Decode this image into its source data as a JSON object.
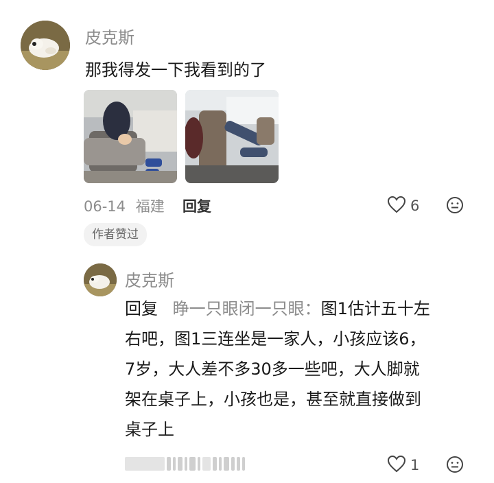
{
  "comment": {
    "author": "皮克斯",
    "text": "那我得发一下我看到的了",
    "date": "06-14",
    "location": "福建",
    "reply_label": "回复",
    "likes": "6",
    "badge": "作者赞过",
    "photos": [
      {
        "alt": "train-seat-photo-1"
      },
      {
        "alt": "train-seat-photo-2"
      }
    ]
  },
  "reply": {
    "author": "皮克斯",
    "prefix": "回复",
    "target": "睁一只眼闭一只眼：",
    "line1": "图1估计五十左",
    "line2": "右吧，图1三连坐是一家人，小孩应该6，",
    "line3": "7岁，大人差不多30多一些吧，大人脚就",
    "line4": "架在桌子上，小孩也是，甚至就直接做到",
    "line5": "桌子上",
    "likes": "1"
  },
  "icons": {
    "like": "heart-outline-icon",
    "more": "smiley-face-icon"
  },
  "colors": {
    "secondary_text": "#8c8c8c",
    "badge_bg": "#f2f2f2"
  }
}
